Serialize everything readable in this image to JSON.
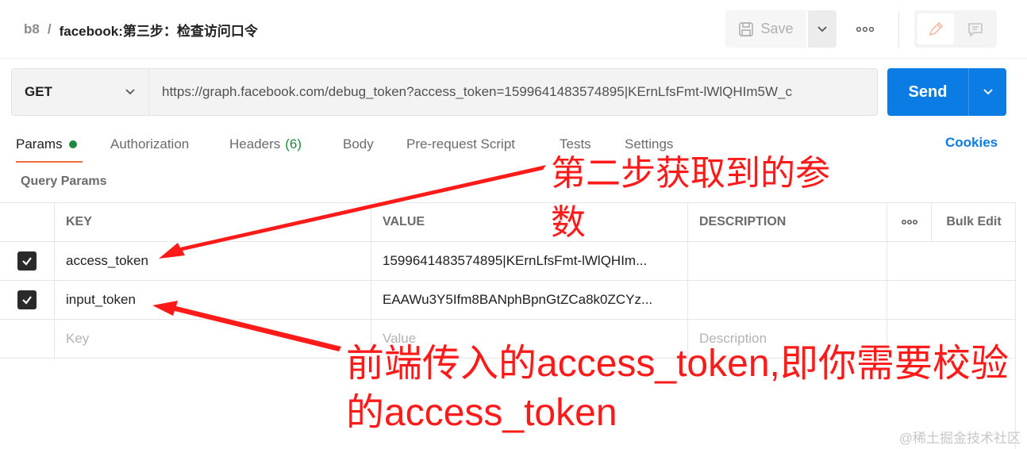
{
  "header": {
    "breadcrumb_parent": "b8",
    "breadcrumb_sep": "/",
    "title": "facebook:第三步：检查访问口令",
    "save_label": "Save",
    "more_icon": "ellipsis-icon",
    "edit_icon": "pencil-icon",
    "comment_icon": "comment-icon"
  },
  "request": {
    "method": "GET",
    "url": "https://graph.facebook.com/debug_token?access_token=1599641483574895|KErnLfsFmt-lWlQHIm5W_c",
    "send_label": "Send"
  },
  "tabs": [
    {
      "label": "Params",
      "active": true
    },
    {
      "label": "Authorization"
    },
    {
      "label": "Headers",
      "count": "(6)"
    },
    {
      "label": "Body"
    },
    {
      "label": "Pre-request Script"
    },
    {
      "label": "Tests"
    },
    {
      "label": "Settings"
    }
  ],
  "cookies_label": "Cookies",
  "query_params_title": "Query Params",
  "table": {
    "headers": {
      "key": "KEY",
      "value": "VALUE",
      "description": "DESCRIPTION",
      "bulk_edit": "Bulk Edit"
    },
    "rows": [
      {
        "checked": true,
        "key": "access_token",
        "value": "1599641483574895|KErnLfsFmt-lWlQHIm..."
      },
      {
        "checked": true,
        "key": "input_token",
        "value": "EAAWu3Y5Ifm8BANphBpnGtZCa8k0ZCYz..."
      }
    ],
    "placeholder": {
      "key": "Key",
      "value": "Value",
      "description": "Description"
    }
  },
  "annotations": {
    "note1_line1": "第二步获取到的参",
    "note1_line2": "数",
    "note2_line1": "前端传入的access_token,即你需要校验",
    "note2_line2": "的access_token",
    "color": "#ff1a1a"
  },
  "watermark": "@稀土掘金技术社区",
  "colors": {
    "accent": "#0b7ce3",
    "tab_underline": "#f26b3a",
    "status_green": "#1f8a3d"
  }
}
